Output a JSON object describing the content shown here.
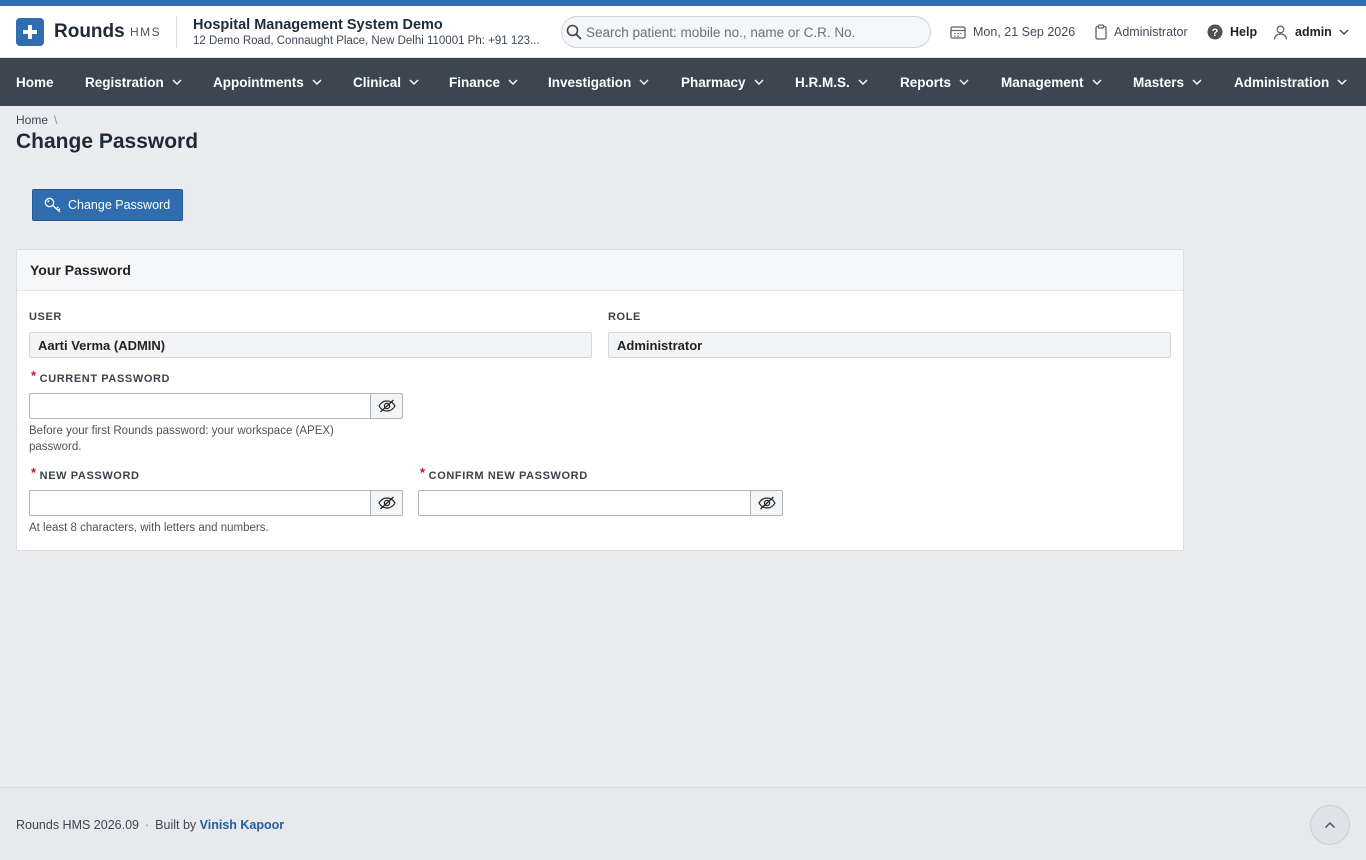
{
  "brand": {
    "name": "Rounds",
    "sub": "HMS",
    "accent": "#2f6cb0"
  },
  "org": {
    "name": "Hospital Management System Demo",
    "address": "12 Demo Road, Connaught Place, New Delhi 110001 Ph: +91 123..."
  },
  "search": {
    "placeholder": "Search patient: mobile no., name or C.R. No.",
    "value": ""
  },
  "header": {
    "date": "Mon, 21 Sep 2026",
    "role": "Administrator",
    "help": "Help",
    "user": "admin"
  },
  "nav": {
    "items": [
      {
        "label": "Home",
        "has_menu": false
      },
      {
        "label": "Registration",
        "has_menu": true
      },
      {
        "label": "Appointments",
        "has_menu": true
      },
      {
        "label": "Clinical",
        "has_menu": true
      },
      {
        "label": "Finance",
        "has_menu": true
      },
      {
        "label": "Investigation",
        "has_menu": true
      },
      {
        "label": "Pharmacy",
        "has_menu": true
      },
      {
        "label": "H.R.M.S.",
        "has_menu": true
      },
      {
        "label": "Reports",
        "has_menu": true
      },
      {
        "label": "Management",
        "has_menu": true
      },
      {
        "label": "Masters",
        "has_menu": true
      },
      {
        "label": "Administration",
        "has_menu": true
      }
    ]
  },
  "breadcrumb": {
    "home": "Home",
    "separator": "\\"
  },
  "page": {
    "title": "Change Password",
    "action_button": "Change Password"
  },
  "panel": {
    "title": "Your Password",
    "user_label": "USER",
    "user_value": "Aarti Verma (ADMIN)",
    "role_label": "ROLE",
    "role_value": "Administrator",
    "current_password_label": "CURRENT PASSWORD",
    "current_password_value": "",
    "current_password_help": "Before your first Rounds password: your workspace (APEX) password.",
    "new_password_label": "NEW PASSWORD",
    "new_password_value": "",
    "new_password_help": "At least 8 characters, with letters and numbers.",
    "confirm_password_label": "CONFIRM NEW PASSWORD",
    "confirm_password_value": "",
    "required_marker": "*"
  },
  "footer": {
    "version": "Rounds HMS 2026.09",
    "dot": "·",
    "built_by": "Built by",
    "author": "Vinish Kapoor"
  }
}
